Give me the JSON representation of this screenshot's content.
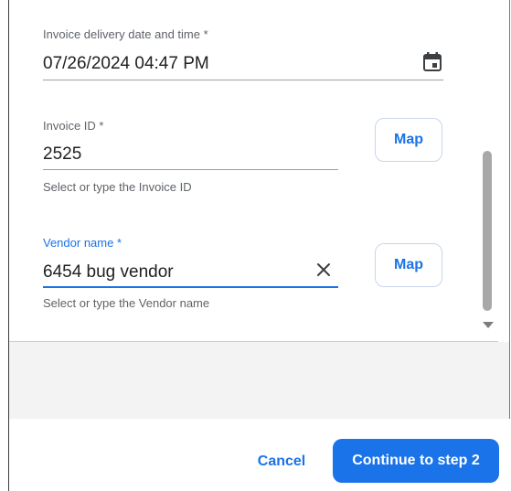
{
  "form": {
    "delivery": {
      "label": "Invoice delivery date and time *",
      "value": "07/26/2024 04:47 PM",
      "icon": "calendar-icon"
    },
    "invoice_id": {
      "label": "Invoice ID *",
      "value": "2525",
      "helper": "Select or type the Invoice ID",
      "map_label": "Map"
    },
    "vendor": {
      "label": "Vendor name *",
      "value": "6454 bug vendor",
      "helper": "Select or type the Vendor name",
      "map_label": "Map",
      "clear_icon": "close-icon"
    }
  },
  "footer": {
    "cancel_label": "Cancel",
    "continue_label": "Continue to step 2"
  },
  "colors": {
    "accent": "#1a73e8",
    "label": "#5f6368",
    "text": "#202124"
  }
}
